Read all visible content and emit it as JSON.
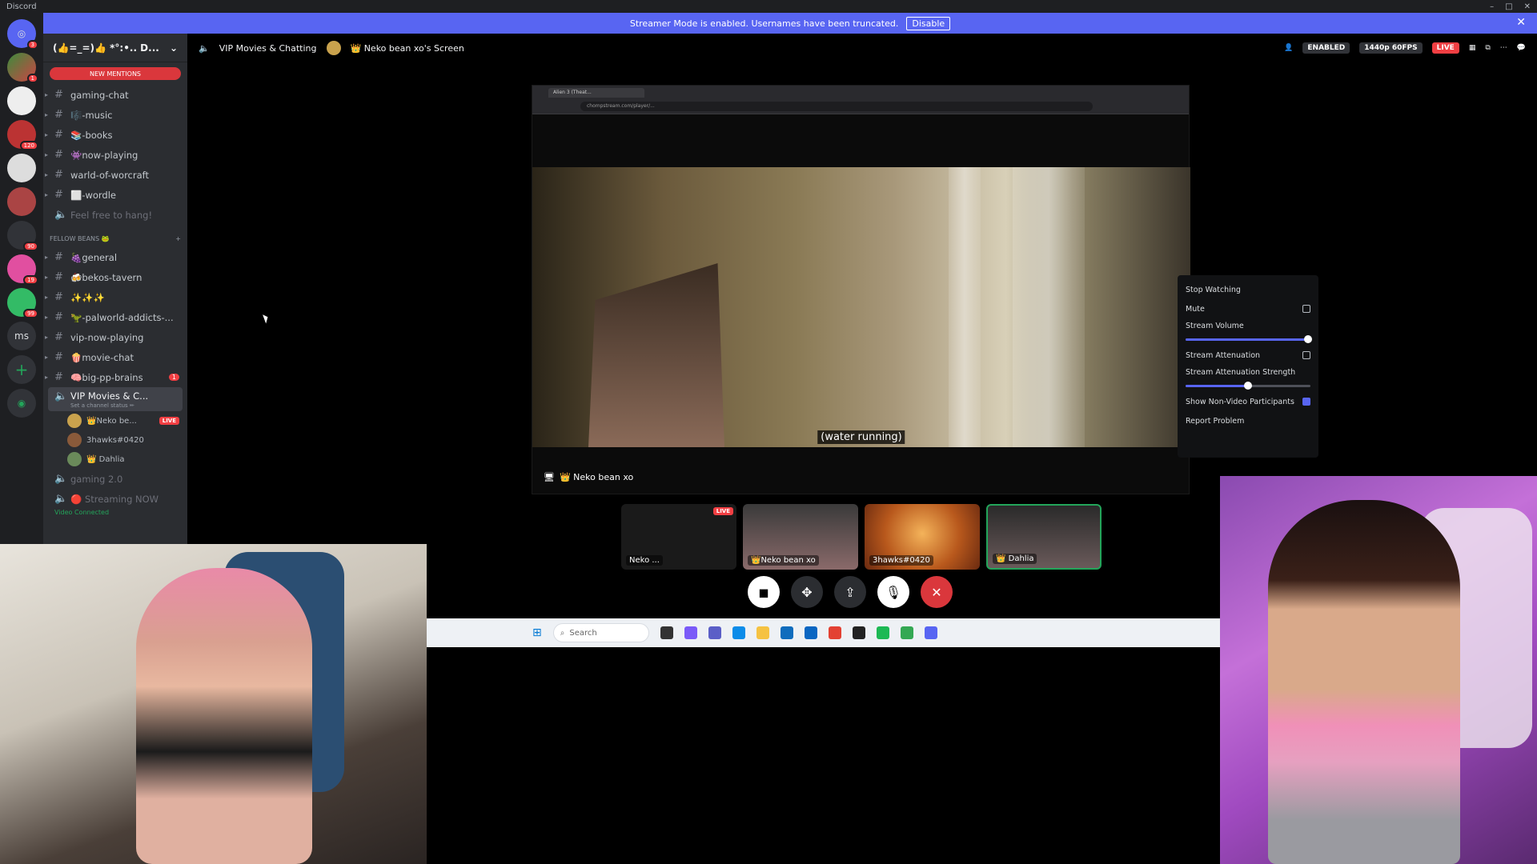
{
  "window": {
    "title": "Discord"
  },
  "streamer_banner": {
    "text": "Streamer Mode is enabled. Usernames have been truncated.",
    "button": "Disable"
  },
  "guild_badges": [
    "3",
    "1",
    "120",
    "90",
    "19",
    "99"
  ],
  "guild_ms": "ms",
  "server": {
    "name": "(👍=_=)👍 *°:•.. D..."
  },
  "new_mentions": "NEW MENTIONS",
  "channels_a": [
    {
      "name": "gaming-chat"
    },
    {
      "name": "🎼-music"
    },
    {
      "name": "📚-books"
    },
    {
      "name": "👾now-playing"
    },
    {
      "name": "warld-of-worcraft"
    },
    {
      "name": "⬜-wordle"
    }
  ],
  "voice_a": {
    "name": "Feel free to hang!"
  },
  "category": {
    "name": "FELLOW BEANS 🐸"
  },
  "channels_b": [
    {
      "name": "🍇general"
    },
    {
      "name": "🍻bekos-tavern"
    },
    {
      "name": "✨✨✨"
    },
    {
      "name": "🦖-palworld-addicts-..."
    },
    {
      "name": "vip-now-playing"
    },
    {
      "name": "🍿movie-chat"
    },
    {
      "name": "🧠big-pp-brains",
      "count": "1"
    }
  ],
  "active_voice": {
    "name": "VIP Movies & C...",
    "status": "Set a channel status ✏"
  },
  "voice_users": [
    {
      "name": "👑Neko be...",
      "live": "LIVE"
    },
    {
      "name": "3hawks#0420"
    },
    {
      "name": "👑 Dahlia"
    }
  ],
  "voice_b": [
    {
      "name": "gaming 2.0"
    },
    {
      "name": "🔴 Streaming NOW"
    }
  ],
  "video_connected": "Video Connected",
  "topbar": {
    "channel": "VIP Movies & Chatting",
    "screen": "👑 Neko bean xo's Screen",
    "enabled": "ENABLED",
    "quality": "1440p 60FPS",
    "live": "LIVE"
  },
  "stream": {
    "subtitle": "(water running)",
    "streamer": "👑 Neko bean xo",
    "browser_tab": "Alien 3 (Theat...",
    "browser_url": "chompstream.com/player/..."
  },
  "menu": {
    "stop_watching": "Stop Watching",
    "mute": "Mute",
    "stream_volume": "Stream Volume",
    "volume_level": 0.98,
    "stream_attenuation": "Stream Attenuation",
    "attenuation_strength": "Stream Attenuation Strength",
    "attenuation_level": 0.5,
    "show_non_video": "Show Non-Video Participants",
    "report": "Report Problem"
  },
  "tiles": [
    {
      "name": "Neko ...",
      "live": "LIVE"
    },
    {
      "name": "👑Neko bean xo"
    },
    {
      "name": "3hawks#0420"
    },
    {
      "name": "👑 Dahlia"
    }
  ],
  "taskbar": {
    "search_placeholder": "Search"
  },
  "colors": {
    "blurple": "#5865f2",
    "red": "#da373c",
    "green": "#23a55a"
  }
}
